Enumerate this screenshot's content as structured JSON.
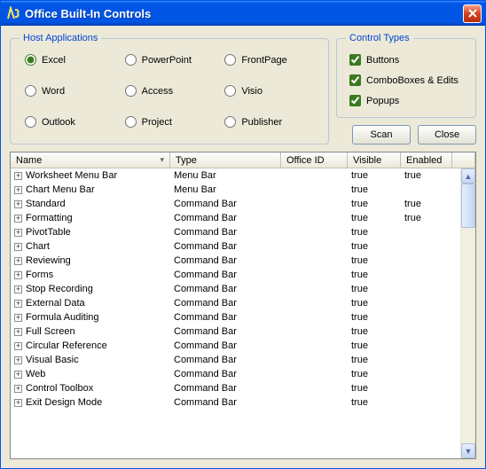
{
  "window": {
    "title": "Office Built-In Controls"
  },
  "groups": {
    "host_title": "Host Applications",
    "types_title": "Control Types"
  },
  "radios": [
    {
      "label": "Excel",
      "checked": true
    },
    {
      "label": "PowerPoint",
      "checked": false
    },
    {
      "label": "FrontPage",
      "checked": false
    },
    {
      "label": "Word",
      "checked": false
    },
    {
      "label": "Access",
      "checked": false
    },
    {
      "label": "Visio",
      "checked": false
    },
    {
      "label": "Outlook",
      "checked": false
    },
    {
      "label": "Project",
      "checked": false
    },
    {
      "label": "Publisher",
      "checked": false
    }
  ],
  "checks": [
    {
      "label": "Buttons",
      "checked": true
    },
    {
      "label": "ComboBoxes & Edits",
      "checked": true
    },
    {
      "label": "Popups",
      "checked": true
    }
  ],
  "buttons": {
    "scan": "Scan",
    "close": "Close"
  },
  "columns": {
    "name": "Name",
    "type": "Type",
    "office": "Office ID",
    "visible": "Visible",
    "enabled": "Enabled"
  },
  "rows": [
    {
      "name": "Worksheet Menu Bar",
      "type": "Menu Bar",
      "office": "",
      "visible": "true",
      "enabled": "true"
    },
    {
      "name": "Chart Menu Bar",
      "type": "Menu Bar",
      "office": "",
      "visible": "true",
      "enabled": ""
    },
    {
      "name": "Standard",
      "type": "Command Bar",
      "office": "",
      "visible": "true",
      "enabled": "true"
    },
    {
      "name": "Formatting",
      "type": "Command Bar",
      "office": "",
      "visible": "true",
      "enabled": "true"
    },
    {
      "name": "PivotTable",
      "type": "Command Bar",
      "office": "",
      "visible": "true",
      "enabled": ""
    },
    {
      "name": "Chart",
      "type": "Command Bar",
      "office": "",
      "visible": "true",
      "enabled": ""
    },
    {
      "name": "Reviewing",
      "type": "Command Bar",
      "office": "",
      "visible": "true",
      "enabled": ""
    },
    {
      "name": "Forms",
      "type": "Command Bar",
      "office": "",
      "visible": "true",
      "enabled": ""
    },
    {
      "name": "Stop Recording",
      "type": "Command Bar",
      "office": "",
      "visible": "true",
      "enabled": ""
    },
    {
      "name": "External Data",
      "type": "Command Bar",
      "office": "",
      "visible": "true",
      "enabled": ""
    },
    {
      "name": "Formula Auditing",
      "type": "Command Bar",
      "office": "",
      "visible": "true",
      "enabled": ""
    },
    {
      "name": "Full Screen",
      "type": "Command Bar",
      "office": "",
      "visible": "true",
      "enabled": ""
    },
    {
      "name": "Circular Reference",
      "type": "Command Bar",
      "office": "",
      "visible": "true",
      "enabled": ""
    },
    {
      "name": "Visual Basic",
      "type": "Command Bar",
      "office": "",
      "visible": "true",
      "enabled": ""
    },
    {
      "name": "Web",
      "type": "Command Bar",
      "office": "",
      "visible": "true",
      "enabled": ""
    },
    {
      "name": "Control Toolbox",
      "type": "Command Bar",
      "office": "",
      "visible": "true",
      "enabled": ""
    },
    {
      "name": "Exit Design Mode",
      "type": "Command Bar",
      "office": "",
      "visible": "true",
      "enabled": ""
    }
  ]
}
